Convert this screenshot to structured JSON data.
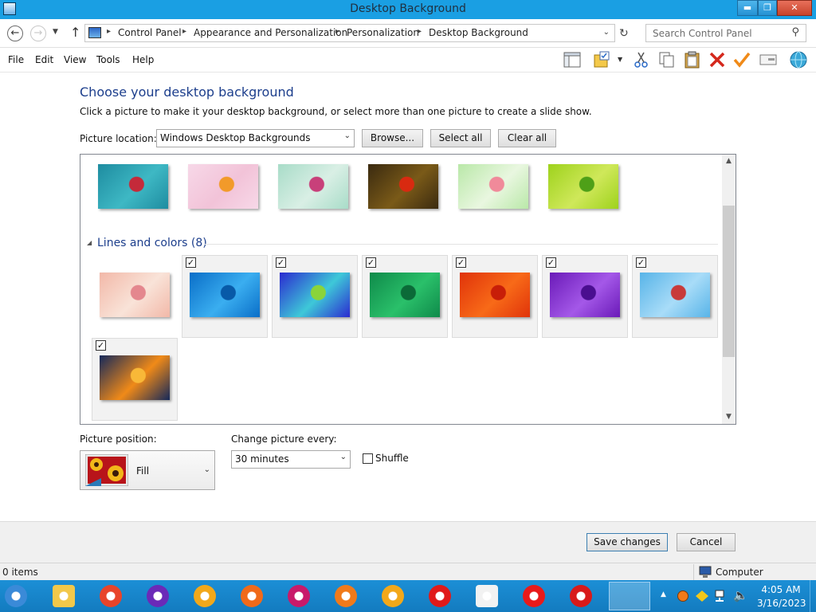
{
  "window": {
    "title": "Desktop Background",
    "buttons": {
      "minimize": "▬",
      "maximize": "❐",
      "close": "✕"
    }
  },
  "address": {
    "crumbs": [
      "Control Panel",
      "Appearance and Personalization",
      "Personalization",
      "Desktop Background"
    ],
    "search_placeholder": "Search Control Panel"
  },
  "menu": [
    "File",
    "Edit",
    "View",
    "Tools",
    "Help"
  ],
  "toolbar_icons": [
    "layout-icon",
    "folder-options-icon",
    "cut-icon",
    "copy-icon",
    "paste-icon",
    "delete-icon",
    "checkmark-icon",
    "properties-icon",
    "globe-icon"
  ],
  "page": {
    "heading": "Choose your desktop background",
    "subtext": "Click a picture to make it your desktop background, or select more than one picture to create a slide show.",
    "picture_location_label": "Picture location:",
    "picture_location_value": "Windows Desktop Backgrounds",
    "browse_label": "Browse...",
    "select_all_label": "Select all",
    "clear_all_label": "Clear all"
  },
  "gallery": {
    "flowers_row": [
      {
        "name": "flower-1",
        "colors": [
          "#1e8ca0",
          "#3eb8c4",
          "#c42a3a"
        ]
      },
      {
        "name": "flower-2",
        "colors": [
          "#f7d8e8",
          "#f2c3d8",
          "#f29a2a"
        ]
      },
      {
        "name": "flower-3",
        "colors": [
          "#a8dcc8",
          "#d9efe5",
          "#c8407a"
        ]
      },
      {
        "name": "flower-4",
        "colors": [
          "#3a2a10",
          "#7a5a18",
          "#d82a10"
        ]
      },
      {
        "name": "flower-5",
        "colors": [
          "#b9e8a8",
          "#e9f7e0",
          "#f08a9a"
        ]
      },
      {
        "name": "flower-6",
        "colors": [
          "#9ed21c",
          "#cfe85a",
          "#4ea018"
        ]
      }
    ],
    "group_title": "Lines and colors (8)",
    "lines_items": [
      {
        "name": "cartoon",
        "checked": false,
        "colors": [
          "#f2b8a8",
          "#f9e3d8",
          "#e4878e"
        ]
      },
      {
        "name": "lines-blue",
        "checked": true,
        "colors": [
          "#0a6ec8",
          "#3aaef0",
          "#085aa8"
        ]
      },
      {
        "name": "lines-multi",
        "checked": true,
        "colors": [
          "#2b2ad0",
          "#3ec8d8",
          "#8ad43a"
        ]
      },
      {
        "name": "lines-green",
        "checked": true,
        "colors": [
          "#0f8a4a",
          "#2ac06a",
          "#0b6a38"
        ]
      },
      {
        "name": "lines-red",
        "checked": true,
        "colors": [
          "#e0330a",
          "#f86a18",
          "#c81e08"
        ]
      },
      {
        "name": "lines-purple",
        "checked": true,
        "colors": [
          "#6a1ab8",
          "#a458e8",
          "#4a0e90"
        ]
      },
      {
        "name": "lines-lightblue",
        "checked": true,
        "colors": [
          "#58b4e8",
          "#a8dcf8",
          "#c83a3a"
        ]
      },
      {
        "name": "lines-orange",
        "checked": true,
        "colors": [
          "#14285a",
          "#f08a18",
          "#f8b838"
        ]
      }
    ]
  },
  "position": {
    "label": "Picture position:",
    "value": "Fill"
  },
  "change": {
    "label": "Change picture every:",
    "value": "30 minutes",
    "shuffle_label": "Shuffle",
    "shuffle_checked": false
  },
  "footer": {
    "save_label": "Save changes",
    "cancel_label": "Cancel"
  },
  "status": {
    "items": "0 items",
    "computer": "Computer"
  },
  "taskbar": {
    "apps": [
      "start-orb-icon",
      "file-explorer-icon",
      "chrome-icon",
      "visual-studio-icon",
      "vpn-icon",
      "firefox-icon",
      "opera-gx-icon",
      "firefox-alt-icon",
      "uc-browser-icon",
      "opera-icon",
      "sublime-icon",
      "yandex-icon",
      "power-icon",
      "control-panel-icon"
    ],
    "time": "4:05 AM",
    "date": "3/16/2023"
  }
}
